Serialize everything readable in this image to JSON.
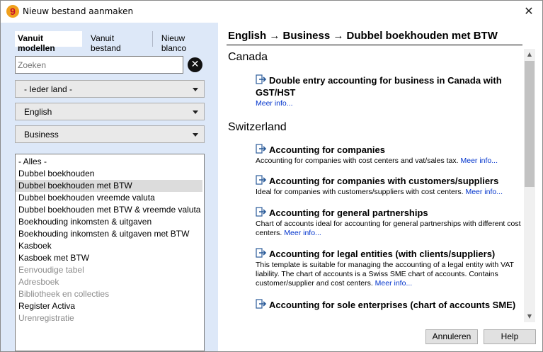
{
  "window": {
    "title": "Nieuw bestand aanmaken",
    "close_glyph": "✕"
  },
  "logo": {
    "glyph": "9"
  },
  "tabs": [
    {
      "label": "Vanuit modellen"
    },
    {
      "label": "Vanuit bestand"
    },
    {
      "label": "Nieuw blanco"
    }
  ],
  "search": {
    "placeholder": "Zoeken",
    "clear_glyph": "✕"
  },
  "filters": {
    "country": "- Ieder land -",
    "language": "English",
    "category": "Business"
  },
  "list": {
    "items": [
      {
        "label": "- Alles -"
      },
      {
        "label": "Dubbel boekhouden"
      },
      {
        "label": "Dubbel boekhouden met BTW"
      },
      {
        "label": "Dubbel boekhouden vreemde valuta"
      },
      {
        "label": "Dubbel boekhouden met BTW & vreemde valuta"
      },
      {
        "label": "Boekhouding inkomsten & uitgaven"
      },
      {
        "label": "Boekhouding inkomsten & uitgaven met BTW"
      },
      {
        "label": "Kasboek"
      },
      {
        "label": "Kasboek met BTW"
      },
      {
        "label": "Eenvoudige tabel"
      },
      {
        "label": "Adresboek"
      },
      {
        "label": "Bibliotheek en collecties"
      },
      {
        "label": "Register Activa"
      },
      {
        "label": "Urenregistratie"
      }
    ]
  },
  "breadcrumb": "English → Business → Dubbel boekhouden met BTW",
  "sections": {
    "canada": {
      "title": "Canada",
      "e1": {
        "title": "Double entry accounting for business in Canada with GST/HST",
        "more": "Meer info..."
      }
    },
    "switzerland": {
      "title": "Switzerland",
      "e1": {
        "title": "Accounting for companies",
        "desc": "Accounting for companies with cost centers and vat/sales tax.",
        "more": "Meer info..."
      },
      "e2": {
        "title": "Accounting for companies with customers/suppliers",
        "desc": "Ideal for companies with customers/suppliers with cost centers.",
        "more": "Meer info..."
      },
      "e3": {
        "title": "Accounting for general partnerships",
        "desc": "Chart of accounts ideal for accounting for general partnerships with different cost centers.",
        "more": "Meer info..."
      },
      "e4": {
        "title": "Accounting for legal entities (with clients/suppliers)",
        "desc": "This template is suitable for managing the accounting of a legal entity with VAT liability. The chart of accounts is a Swiss SME chart of accounts. Contains customer/supplier and cost centers.",
        "more": "Meer info..."
      },
      "e5": {
        "title": "Accounting for sole enterprises (chart of accounts SME)"
      }
    }
  },
  "scrollbar": {
    "up_glyph": "▲",
    "down_glyph": "▼"
  },
  "buttons": {
    "cancel": "Annuleren",
    "help": "Help"
  },
  "colors": {
    "left_panel_bg": "#dde8f8",
    "link": "#0033cc",
    "selected_row": "#dcdcdc",
    "logo_orange": "#f0a01c",
    "logo_red": "#c8102e"
  },
  "icons": {
    "template_item": "document-arrow-icon"
  }
}
